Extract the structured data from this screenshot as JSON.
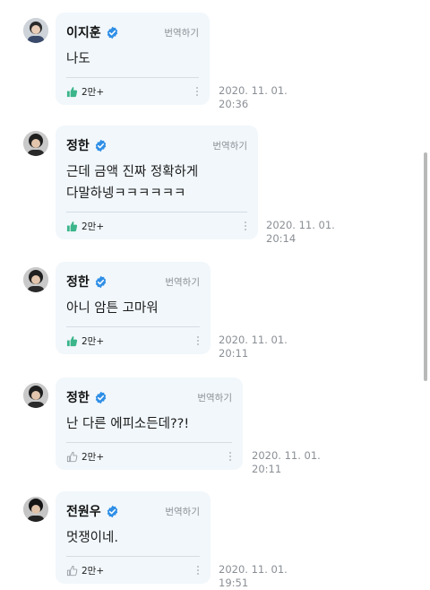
{
  "messages": [
    {
      "name": "이지훈",
      "translate": "번역하기",
      "text": "나도",
      "likes": "2만+",
      "liked": true,
      "date": "2020. 11. 01.",
      "time": "20:36"
    },
    {
      "name": "정한",
      "translate": "번역하기",
      "text": "근데 금액 진짜 정확하게\n다말하넹ㅋㅋㅋㅋㅋㅋ",
      "likes": "2만+",
      "liked": true,
      "date": "2020. 11. 01.",
      "time": "20:14"
    },
    {
      "name": "정한",
      "translate": "번역하기",
      "text": "아니 암튼 고마워",
      "likes": "2만+",
      "liked": true,
      "date": "2020. 11. 01.",
      "time": "20:11"
    },
    {
      "name": "정한",
      "translate": "번역하기",
      "text": "난 다른 에피소든데??!",
      "likes": "2만+",
      "liked": false,
      "date": "2020. 11. 01.",
      "time": "20:11"
    },
    {
      "name": "전원우",
      "translate": "번역하기",
      "text": "멋쟁이네.",
      "likes": "2만+",
      "liked": false,
      "date": "2020. 11. 01.",
      "time": "19:51"
    }
  ],
  "colors": {
    "accent": "#2f8fe6",
    "bubble": "#f1f7fb",
    "like_active": "#3bb58a",
    "muted": "#8a8f95"
  },
  "icons": {
    "verified": "verified-badge-icon",
    "like": "thumbs-up-icon",
    "more": "more-vertical-icon"
  }
}
